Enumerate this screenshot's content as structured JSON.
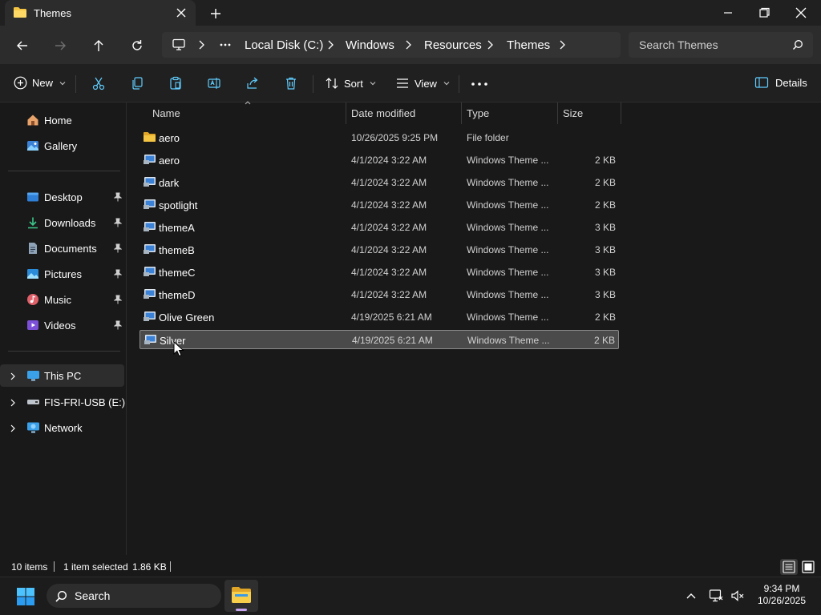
{
  "window": {
    "tab_title": "Themes"
  },
  "address": {
    "crumbs": [
      "Local Disk (C:)",
      "Windows",
      "Resources",
      "Themes"
    ],
    "search_placeholder": "Search Themes"
  },
  "toolbar": {
    "new_label": "New",
    "sort_label": "Sort",
    "view_label": "View",
    "details_label": "Details"
  },
  "sidebar": {
    "items": [
      {
        "label": "Home",
        "icon": "home-icon"
      },
      {
        "label": "Gallery",
        "icon": "gallery-icon"
      },
      {
        "label": "Desktop",
        "icon": "desktop-icon",
        "pinned": true
      },
      {
        "label": "Downloads",
        "icon": "downloads-icon",
        "pinned": true
      },
      {
        "label": "Documents",
        "icon": "documents-icon",
        "pinned": true
      },
      {
        "label": "Pictures",
        "icon": "pictures-icon",
        "pinned": true
      },
      {
        "label": "Music",
        "icon": "music-icon",
        "pinned": true
      },
      {
        "label": "Videos",
        "icon": "videos-icon",
        "pinned": true
      }
    ],
    "tree": [
      {
        "label": "This PC",
        "icon": "computer-icon",
        "selected": true
      },
      {
        "label": "FIS-FRI-USB (E:)",
        "icon": "usb-drive-icon"
      },
      {
        "label": "Network",
        "icon": "network-icon"
      }
    ]
  },
  "columns": [
    "Name",
    "Date modified",
    "Type",
    "Size"
  ],
  "files": [
    {
      "name": "aero",
      "date": "10/26/2025 9:25 PM",
      "type": "File folder",
      "size": "",
      "kind": "folder"
    },
    {
      "name": "aero",
      "date": "4/1/2024 3:22 AM",
      "type": "Windows Theme ...",
      "size": "2 KB",
      "kind": "theme"
    },
    {
      "name": "dark",
      "date": "4/1/2024 3:22 AM",
      "type": "Windows Theme ...",
      "size": "2 KB",
      "kind": "theme"
    },
    {
      "name": "spotlight",
      "date": "4/1/2024 3:22 AM",
      "type": "Windows Theme ...",
      "size": "2 KB",
      "kind": "theme"
    },
    {
      "name": "themeA",
      "date": "4/1/2024 3:22 AM",
      "type": "Windows Theme ...",
      "size": "3 KB",
      "kind": "theme"
    },
    {
      "name": "themeB",
      "date": "4/1/2024 3:22 AM",
      "type": "Windows Theme ...",
      "size": "3 KB",
      "kind": "theme"
    },
    {
      "name": "themeC",
      "date": "4/1/2024 3:22 AM",
      "type": "Windows Theme ...",
      "size": "3 KB",
      "kind": "theme"
    },
    {
      "name": "themeD",
      "date": "4/1/2024 3:22 AM",
      "type": "Windows Theme ...",
      "size": "3 KB",
      "kind": "theme"
    },
    {
      "name": "Olive Green",
      "date": "4/19/2025 6:21 AM",
      "type": "Windows Theme ...",
      "size": "2 KB",
      "kind": "theme"
    },
    {
      "name": "Silver",
      "date": "4/19/2025 6:21 AM",
      "type": "Windows Theme ...",
      "size": "2 KB",
      "kind": "theme",
      "selected": true
    }
  ],
  "status": {
    "item_count": "10 items",
    "selection": "1 item selected",
    "selection_size": "1.86 KB"
  },
  "taskbar": {
    "search_label": "Search",
    "time": "9:34 PM",
    "date": "10/26/2025"
  },
  "colors": {
    "folder": "#f4c542",
    "accent": "#4cc2ff",
    "selection": "#4a4a4a"
  }
}
